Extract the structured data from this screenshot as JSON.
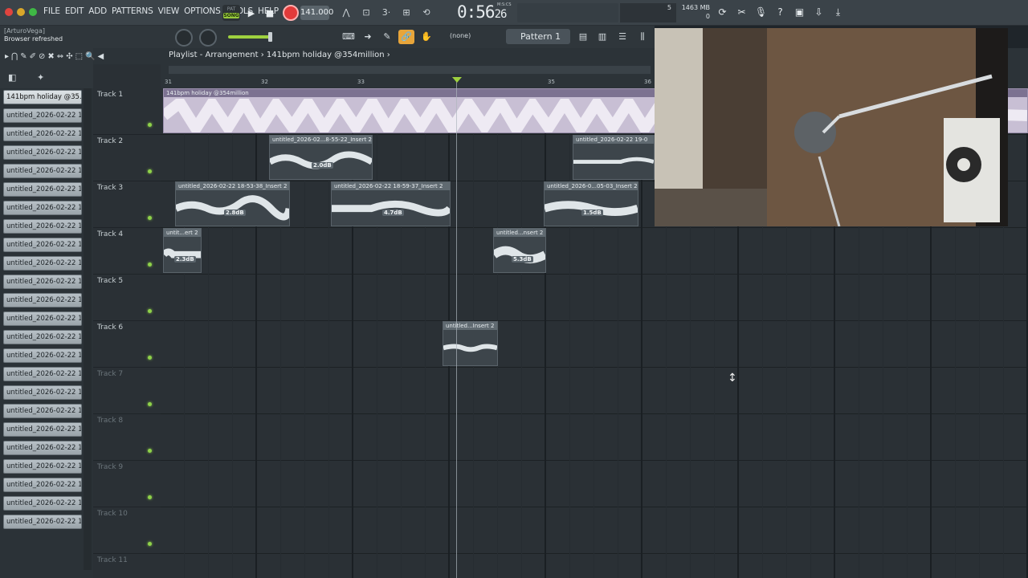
{
  "menu": [
    "FILE",
    "EDIT",
    "ADD",
    "PATTERNS",
    "VIEW",
    "OPTIONS",
    "TOOLS",
    "HELP"
  ],
  "transport": {
    "pat": "PAT",
    "song": "SONG",
    "tempo": "141.000",
    "time_main": "0:56",
    "time_sub": "26",
    "time_units": "M:S:CS"
  },
  "monitor": {
    "value": "5"
  },
  "cpu": {
    "mem": "1463 MB",
    "poly": "0"
  },
  "hint": {
    "user": "[ArturoVega]",
    "message": "Browser refreshed"
  },
  "toolbar2": {
    "none_label": "(none)",
    "pattern_label": "Pattern 1"
  },
  "playlist": {
    "title": "Playlist - Arrangement",
    "arrangement": "141bpm holiday @354million"
  },
  "browser": {
    "items": [
      "141bpm holiday @35...",
      "untitled_2026-02-22 17-...",
      "untitled_2026-02-22 17-...",
      "untitled_2026-02-22 17-...",
      "untitled_2026-02-22 17-...",
      "untitled_2026-02-22 17-...",
      "untitled_2026-02-22 17-...",
      "untitled_2026-02-22 17-...",
      "untitled_2026-02-22 17-...",
      "untitled_2026-02-22 17-...",
      "untitled_2026-02-22 17-...",
      "untitled_2026-02-22 17-...",
      "untitled_2026-02-22 17-...",
      "untitled_2026-02-22 17-...",
      "untitled_2026-02-22 18-...",
      "untitled_2026-02-22 18-...",
      "untitled_2026-02-22 18-...",
      "untitled_2026-02-22 18-...",
      "untitled_2026-02-22 18-...",
      "untitled_2026-02-22 18-...",
      "untitled_2026-02-22 18-...",
      "untitled_2026-02-22 18-...",
      "untitled_2026-02-22 18-...",
      "untitled_2026-02-22 18-..."
    ]
  },
  "ruler": [
    "31",
    "32",
    "33",
    "35",
    "36"
  ],
  "tracks": [
    "Track 1",
    "Track 2",
    "Track 3",
    "Track 4",
    "Track 5",
    "Track 6",
    "Track 7",
    "Track 8",
    "Track 9",
    "Track 10",
    "Track 11"
  ],
  "clips": [
    {
      "title": "141bpm holiday @354million",
      "gain": ""
    },
    {
      "title": "untitled_2026-02...8-55-22_Insert 2",
      "gain": "2.0dB"
    },
    {
      "title": "untitled_2026-02-22 19-0",
      "gain": ""
    },
    {
      "title": "untitled_2026-02-22 18-53-38_Insert 2",
      "gain": "2.8dB"
    },
    {
      "title": "untitled_2026-02-22 18-59-37_Insert 2",
      "gain": "4.7dB"
    },
    {
      "title": "untitled_2026-0...05-03_Insert 2",
      "gain": "1.5dB"
    },
    {
      "title": "untit...ert 2",
      "gain": "2.3dB"
    },
    {
      "title": "untitled...nsert 2",
      "gain": "5.3dB"
    },
    {
      "title": "untitled...Insert 2",
      "gain": ""
    }
  ]
}
